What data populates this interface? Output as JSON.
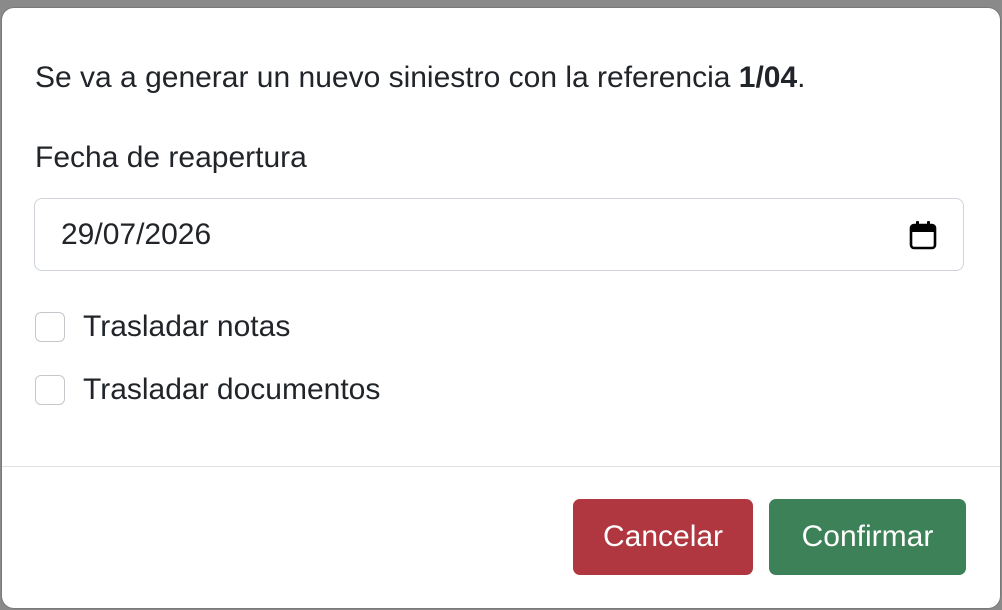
{
  "dialog": {
    "message_prefix": "Se va a generar un nuevo siniestro con la referencia ",
    "reference": "1/04",
    "message_suffix": "."
  },
  "reopen_date": {
    "label": "Fecha de reapertura",
    "value": "29/07/2026",
    "icon": "calendar-icon"
  },
  "options": {
    "transfer_notes": {
      "label": "Trasladar notas",
      "checked": false
    },
    "transfer_documents": {
      "label": "Trasladar documentos",
      "checked": false
    }
  },
  "footer": {
    "cancel_label": "Cancelar",
    "confirm_label": "Confirmar"
  },
  "colors": {
    "cancel": "#b0363f",
    "confirm": "#3d8158",
    "backdrop": "#8a8a8a"
  }
}
